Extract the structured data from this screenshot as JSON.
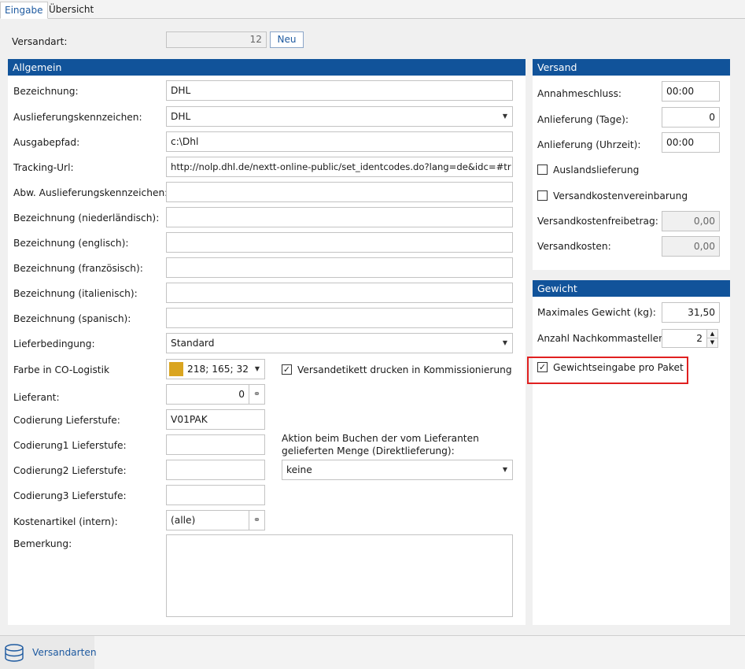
{
  "tabs": [
    "Eingabe",
    "Übersicht"
  ],
  "versandart": {
    "label": "Versandart:",
    "value": "12",
    "new_button": "Neu"
  },
  "allgemein": {
    "title": "Allgemein",
    "bezeichnung": {
      "label": "Bezeichnung:",
      "value": "DHL"
    },
    "auslieferungskennzeichen": {
      "label": "Auslieferungskennzeichen:",
      "value": "DHL"
    },
    "ausgabepfad": {
      "label": "Ausgabepfad:",
      "value": "c:\\Dhl"
    },
    "tracking_url": {
      "label": "Tracking-Url:",
      "value": "http://nolp.dhl.de/nextt-online-public/set_identcodes.do?lang=de&idc=#tr"
    },
    "abw_kennzeichen": {
      "label": "Abw. Auslieferungskennzeichen:",
      "value": ""
    },
    "bez_nl": {
      "label": "Bezeichnung (niederländisch):",
      "value": ""
    },
    "bez_en": {
      "label": "Bezeichnung (englisch):",
      "value": ""
    },
    "bez_fr": {
      "label": "Bezeichnung (französisch):",
      "value": ""
    },
    "bez_it": {
      "label": "Bezeichnung (italienisch):",
      "value": ""
    },
    "bez_es": {
      "label": "Bezeichnung (spanisch):",
      "value": ""
    },
    "lieferbedingung": {
      "label": "Lieferbedingung:",
      "value": "Standard"
    },
    "farbe": {
      "label": "Farbe in CO-Logistik",
      "value": "218; 165; 32",
      "swatch": "#daa520"
    },
    "versandetikett": {
      "label": "Versandetikett drucken in Kommissionierung",
      "checked": true
    },
    "lieferant": {
      "label": "Lieferant:",
      "value": "0"
    },
    "codierung": {
      "label": "Codierung Lieferstufe:",
      "value": "V01PAK"
    },
    "codierung1": {
      "label": "Codierung1 Lieferstufe:",
      "value": ""
    },
    "codierung2": {
      "label": "Codierung2 Lieferstufe:",
      "value": ""
    },
    "codierung3": {
      "label": "Codierung3 Lieferstufe:",
      "value": ""
    },
    "aktion": {
      "label_line1": "Aktion beim Buchen der vom Lieferanten",
      "label_line2": "gelieferten Menge (Direktlieferung):",
      "value": "keine"
    },
    "kostenartikel": {
      "label": "Kostenartikel (intern):",
      "value": "(alle)"
    },
    "bemerkung": {
      "label": "Bemerkung:",
      "value": ""
    }
  },
  "versand": {
    "title": "Versand",
    "annahmeschluss": {
      "label": "Annahmeschluss:",
      "value": "00:00"
    },
    "anlieferung_tage": {
      "label": "Anlieferung (Tage):",
      "value": "0"
    },
    "anlieferung_uhrzeit": {
      "label": "Anlieferung (Uhrzeit):",
      "value": "00:00"
    },
    "auslandslieferung": {
      "label": "Auslandslieferung",
      "checked": false
    },
    "vereinbarung": {
      "label": "Versandkostenvereinbarung",
      "checked": false
    },
    "freibetrag": {
      "label": "Versandkostenfreibetrag:",
      "value": "0,00"
    },
    "versandkosten": {
      "label": "Versandkosten:",
      "value": "0,00"
    }
  },
  "gewicht": {
    "title": "Gewicht",
    "max_gewicht": {
      "label": "Maximales Gewicht (kg):",
      "value": "31,50"
    },
    "nachkommastellen": {
      "label": "Anzahl Nachkommastellen:",
      "value": "2"
    },
    "pro_paket": {
      "label": "Gewichtseingabe pro Paket",
      "checked": true
    }
  },
  "footer": {
    "label": "Versandarten"
  },
  "colors": {
    "header_blue": "#11539a",
    "highlight_red": "#e02020"
  }
}
